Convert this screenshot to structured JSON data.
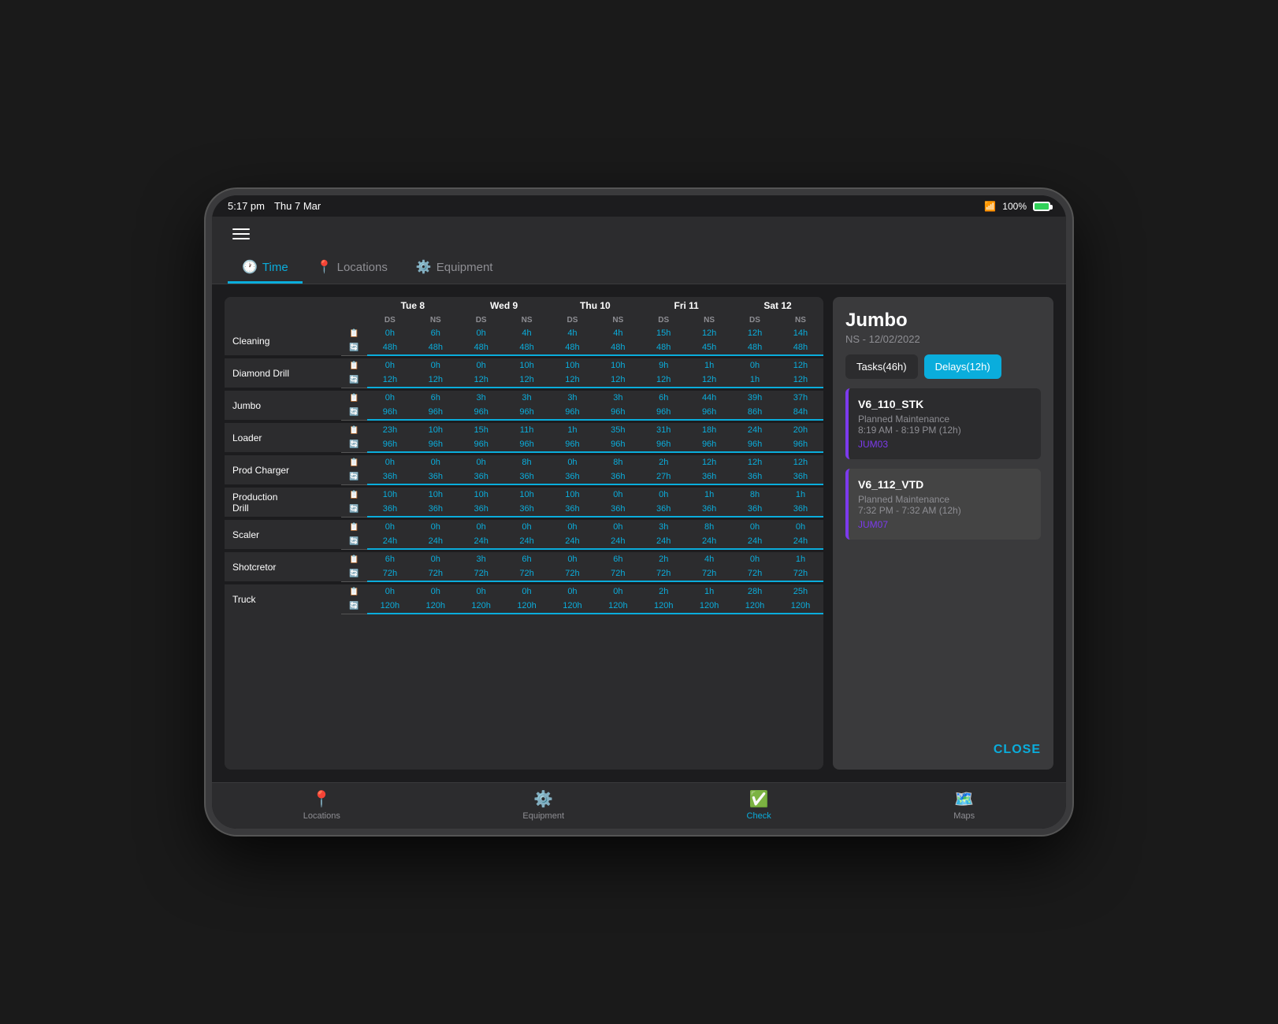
{
  "statusBar": {
    "time": "5:17 pm",
    "date": "Thu 7 Mar",
    "battery": "100%"
  },
  "tabs": [
    {
      "id": "time",
      "label": "Time",
      "active": true
    },
    {
      "id": "locations",
      "label": "Locations",
      "active": false
    },
    {
      "id": "equipment",
      "label": "Equipment",
      "active": false
    }
  ],
  "schedule": {
    "columns": [
      {
        "day": "Tue 8",
        "subs": [
          "DS",
          "NS"
        ]
      },
      {
        "day": "Wed 9",
        "subs": [
          "DS",
          "NS"
        ]
      },
      {
        "day": "Thu 10",
        "subs": [
          "DS",
          "NS"
        ]
      },
      {
        "day": "Fri 11",
        "subs": [
          "DS",
          "NS"
        ]
      },
      {
        "day": "Sat 12",
        "subs": [
          "DS",
          "NS"
        ]
      }
    ],
    "rows": [
      {
        "label": "Cleaning",
        "top": [
          "0h",
          "6h",
          "0h",
          "4h",
          "4h",
          "4h",
          "15h",
          "12h",
          "12h",
          "14h"
        ],
        "bottom": [
          "48h",
          "48h",
          "48h",
          "48h",
          "48h",
          "48h",
          "48h",
          "45h",
          "48h",
          "48h"
        ]
      },
      {
        "label": "Diamond Drill",
        "top": [
          "0h",
          "0h",
          "0h",
          "10h",
          "10h",
          "10h",
          "9h",
          "1h",
          "0h",
          "12h"
        ],
        "bottom": [
          "12h",
          "12h",
          "12h",
          "12h",
          "12h",
          "12h",
          "12h",
          "12h",
          "1h",
          "12h"
        ]
      },
      {
        "label": "Jumbo",
        "top": [
          "0h",
          "6h",
          "3h",
          "3h",
          "3h",
          "3h",
          "6h",
          "44h",
          "39h",
          "37h"
        ],
        "bottom": [
          "96h",
          "96h",
          "96h",
          "96h",
          "96h",
          "96h",
          "96h",
          "96h",
          "86h",
          "84h"
        ]
      },
      {
        "label": "Loader",
        "top": [
          "23h",
          "10h",
          "15h",
          "11h",
          "1h",
          "35h",
          "31h",
          "18h",
          "24h",
          "20h"
        ],
        "bottom": [
          "96h",
          "96h",
          "96h",
          "96h",
          "96h",
          "96h",
          "96h",
          "96h",
          "96h",
          "96h"
        ]
      },
      {
        "label": "Prod Charger",
        "top": [
          "0h",
          "0h",
          "0h",
          "8h",
          "0h",
          "8h",
          "2h",
          "12h",
          "12h",
          "12h"
        ],
        "bottom": [
          "36h",
          "36h",
          "36h",
          "36h",
          "36h",
          "36h",
          "27h",
          "36h",
          "36h",
          "36h"
        ]
      },
      {
        "label": "Production\nDrill",
        "top": [
          "10h",
          "10h",
          "10h",
          "10h",
          "10h",
          "0h",
          "0h",
          "1h",
          "8h",
          "1h"
        ],
        "bottom": [
          "36h",
          "36h",
          "36h",
          "36h",
          "36h",
          "36h",
          "36h",
          "36h",
          "36h",
          "36h"
        ]
      },
      {
        "label": "Scaler",
        "top": [
          "0h",
          "0h",
          "0h",
          "0h",
          "0h",
          "0h",
          "3h",
          "8h",
          "0h",
          "0h"
        ],
        "bottom": [
          "24h",
          "24h",
          "24h",
          "24h",
          "24h",
          "24h",
          "24h",
          "24h",
          "24h",
          "24h"
        ]
      },
      {
        "label": "Shotcretor",
        "top": [
          "6h",
          "0h",
          "3h",
          "6h",
          "0h",
          "6h",
          "2h",
          "4h",
          "0h",
          "1h"
        ],
        "bottom": [
          "72h",
          "72h",
          "72h",
          "72h",
          "72h",
          "72h",
          "72h",
          "72h",
          "72h",
          "72h"
        ]
      },
      {
        "label": "Truck",
        "top": [
          "0h",
          "0h",
          "0h",
          "0h",
          "0h",
          "0h",
          "2h",
          "1h",
          "28h",
          "25h"
        ],
        "bottom": [
          "120h",
          "120h",
          "120h",
          "120h",
          "120h",
          "120h",
          "120h",
          "120h",
          "120h",
          "120h"
        ]
      }
    ]
  },
  "sidePanel": {
    "title": "Jumbo",
    "subtitle": "NS - 12/02/2022",
    "tabs": [
      {
        "label": "Tasks(46h)",
        "active": false
      },
      {
        "label": "Delays(12h)",
        "active": true
      }
    ],
    "delays": [
      {
        "id": "V6_110_STK",
        "type": "Planned Maintenance",
        "time": "8:19 AM - 8:19 PM (12h)",
        "unit": "JUM03",
        "selected": false
      },
      {
        "id": "V6_112_VTD",
        "type": "Planned Maintenance",
        "time": "7:32 PM - 7:32 AM (12h)",
        "unit": "JUM07",
        "selected": true
      }
    ],
    "closeLabel": "CLOSE"
  },
  "bottomNav": [
    {
      "label": "Locations",
      "icon": "📍",
      "active": false
    },
    {
      "label": "Equipment",
      "icon": "🔧",
      "active": false
    },
    {
      "label": "Check",
      "icon": "✅",
      "active": true
    },
    {
      "label": "Maps",
      "icon": "🗺️",
      "active": false
    }
  ]
}
